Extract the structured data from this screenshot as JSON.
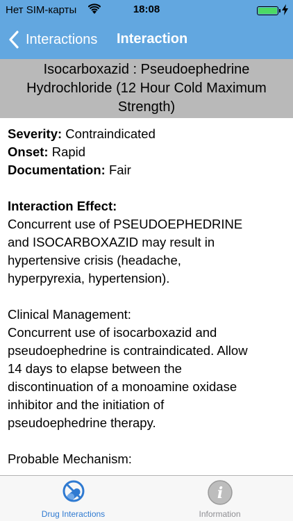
{
  "status_bar": {
    "carrier": "Нет SIM-карты",
    "time": "18:08"
  },
  "nav": {
    "back_label": "Interactions",
    "title": "Interaction"
  },
  "interaction": {
    "title": "Isocarboxazid : Pseudoephedrine Hydrochloride (12 Hour Cold Maximum Strength)",
    "severity_label": "Severity:",
    "severity_value": "Contraindicated",
    "onset_label": "Onset:",
    "onset_value": "Rapid",
    "documentation_label": "Documentation:",
    "documentation_value": "Fair",
    "effect_heading": "Interaction Effect:",
    "effect_lines": [
      "Concurrent use of PSEUDOEPHEDRINE",
      "and ISOCARBOXAZID may result in",
      "hypertensive crisis (headache,",
      "hyperpyrexia, hypertension)."
    ],
    "management_heading": "Clinical Management:",
    "management_lines": [
      "Concurrent use of isocarboxazid and",
      "pseudoephedrine is contraindicated. Allow",
      "14 days to elapse between the",
      "discontinuation of a monoamine oxidase",
      "inhibitor and the initiation of",
      "pseudoephedrine therapy."
    ],
    "mechanism_heading": "Probable Mechanism:"
  },
  "tabs": [
    {
      "label": "Drug Interactions",
      "icon": "no-pills-icon",
      "selected": true
    },
    {
      "label": "Information",
      "icon": "info-icon",
      "selected": false
    }
  ],
  "colors": {
    "header_blue": "#62a7e0",
    "band_grey": "#b9b9b9",
    "tab_active": "#2f7ad1",
    "tab_inactive": "#8e8e93"
  }
}
